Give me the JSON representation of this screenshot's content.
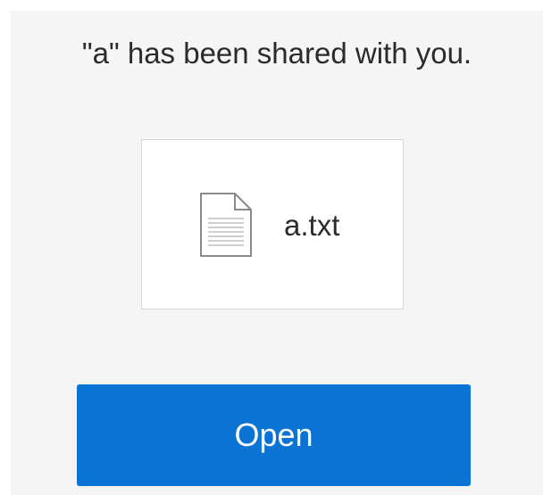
{
  "share_dialog": {
    "message": "\"a\" has been shared with you.",
    "file": {
      "name": "a.txt",
      "icon": "text-file-icon"
    },
    "open_button_label": "Open"
  },
  "colors": {
    "panel_background": "#f5f5f5",
    "button_background": "#0a73d4",
    "button_text": "#ffffff",
    "text": "#2b2b2b"
  }
}
